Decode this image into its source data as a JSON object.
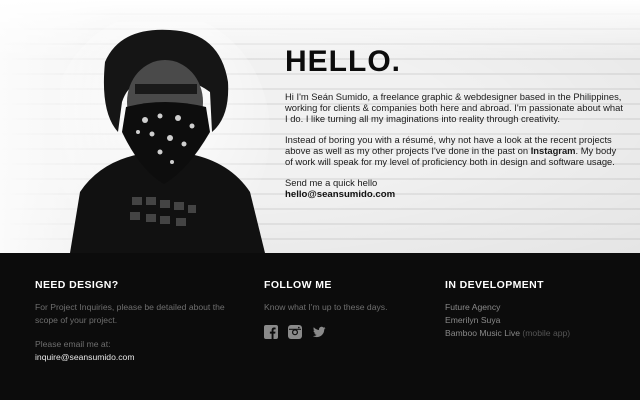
{
  "hero": {
    "title": "HELLO.",
    "para1": "Hi I'm Seán Sumido, a freelance graphic & webdesigner based in the Philippines, working for clients & companies both here and abroad. I'm passionate about what I do. I like turning all my imaginations into reality through creativity.",
    "para2_start": "Instead of boring you with a résumé, why not have a look at the recent projects above as well as my other projects I've done in the past on ",
    "para2_link": "Instagram",
    "para2_end": ". My body of work will speak for my level of proficiency both in design and software usage.",
    "cta": "Send me a quick hello",
    "email": "hello@seansumido.com"
  },
  "footer": {
    "need_design": {
      "heading": "NEED DESIGN?",
      "text": "For Project Inquiries, please be detailed about the scope of your project.",
      "email_label": "Please email me at:",
      "email": "inquire@seansumido.com"
    },
    "follow": {
      "heading": "FOLLOW ME",
      "text": "Know what I'm up to these days.",
      "icons": [
        "facebook-icon",
        "instagram-icon",
        "twitter-icon"
      ]
    },
    "development": {
      "heading": "IN DEVELOPMENT",
      "items": [
        {
          "label": "Future Agency",
          "tag": ""
        },
        {
          "label": "Emerilyn Suya",
          "tag": ""
        },
        {
          "label": "Bamboo Music Live",
          "tag": "(mobile app)"
        }
      ]
    }
  },
  "colors": {
    "footer_bg": "#0c0c0c",
    "muted_text": "#6f6f6f",
    "icon": "#8a8a8a"
  }
}
